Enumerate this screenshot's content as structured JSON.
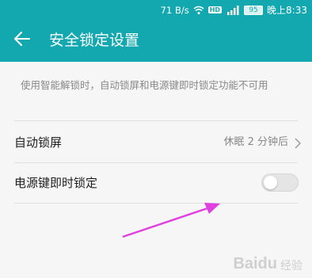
{
  "status_bar": {
    "network_speed": "71 B/s",
    "hd_badge": "HD",
    "signal_label": "4G",
    "battery": "95",
    "time": "晚上8:33"
  },
  "toolbar": {
    "title": "安全锁定设置"
  },
  "info": {
    "text": "使用智能解锁时，自动锁屏和电源键即时锁定功能不可用"
  },
  "settings": {
    "auto_lock": {
      "label": "自动锁屏",
      "value": "休眠 2 分钟后"
    },
    "power_key_lock": {
      "label": "电源键即时锁定",
      "enabled": false
    }
  },
  "watermark": {
    "logo": "Baidu",
    "sub": "经验"
  },
  "colors": {
    "accent": "#13a8b0",
    "annotation_arrow": "#e040e0"
  }
}
